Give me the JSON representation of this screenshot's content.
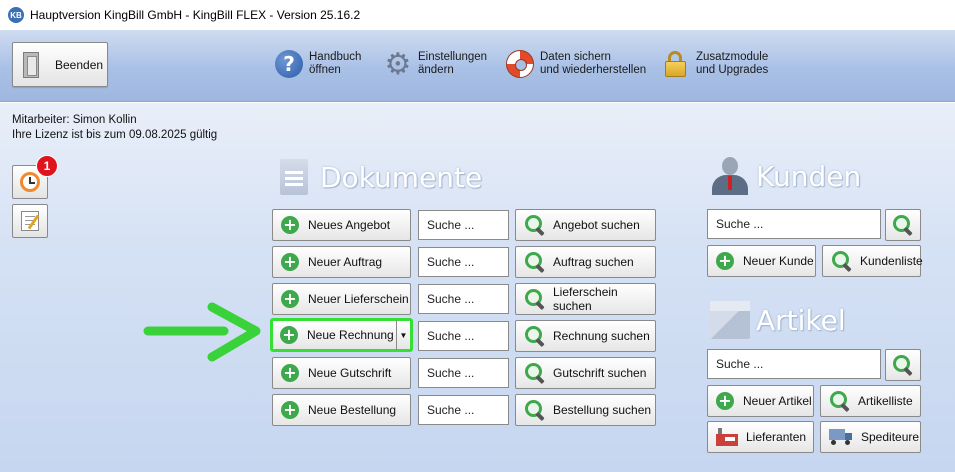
{
  "window": {
    "title": "Hauptversion KingBill GmbH - KingBill FLEX - Version 25.16.2",
    "logo_text": "KB"
  },
  "toolbar": {
    "quit_label": "Beenden",
    "items": [
      {
        "label": "Handbuch\nöffnen",
        "icon": "help-icon"
      },
      {
        "label": "Einstellungen\nändern",
        "icon": "gear-icon"
      },
      {
        "label": "Daten sichern\nund wiederherstellen",
        "icon": "lifebuoy-icon"
      },
      {
        "label": "Zusatzmodule\nund Upgrades",
        "icon": "lock-icon"
      }
    ]
  },
  "status": {
    "employee": "Mitarbeiter: Simon Kollin",
    "license": "Ihre Lizenz ist bis zum 09.08.2025 gültig"
  },
  "side": {
    "reminder_count": "1"
  },
  "documents": {
    "title": "Dokumente",
    "search_placeholder": "Suche ...",
    "rows": [
      {
        "new_label": "Neues Angebot",
        "search_label": "Angebot suchen"
      },
      {
        "new_label": "Neuer Auftrag",
        "search_label": "Auftrag suchen"
      },
      {
        "new_label": "Neuer Lieferschein",
        "search_label": "Lieferschein suchen"
      },
      {
        "new_label": "Neue Rechnung",
        "search_label": "Rechnung suchen"
      },
      {
        "new_label": "Neue Gutschrift",
        "search_label": "Gutschrift suchen"
      },
      {
        "new_label": "Neue Bestellung",
        "search_label": "Bestellung suchen"
      }
    ]
  },
  "customers": {
    "title": "Kunden",
    "search_placeholder": "Suche ...",
    "new_label": "Neuer Kunde",
    "list_label": "Kundenliste"
  },
  "articles": {
    "title": "Artikel",
    "search_placeholder": "Suche ...",
    "new_label": "Neuer Artikel",
    "list_label": "Artikelliste",
    "suppliers_label": "Lieferanten",
    "carriers_label": "Spediteure"
  },
  "colors": {
    "accent_green": "#3ea84c",
    "highlight_green": "#33e033",
    "badge_red": "#e0141d"
  }
}
